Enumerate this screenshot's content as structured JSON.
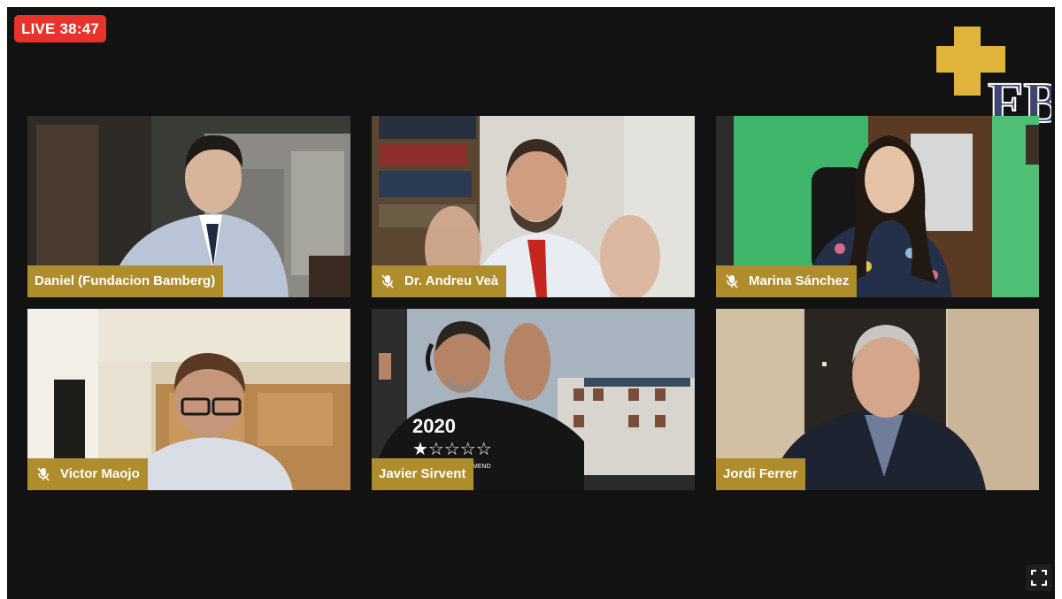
{
  "live": {
    "label": "LIVE",
    "elapsed": "38:47"
  },
  "logo": {
    "letters": "FB",
    "cross_color": "#e0b43a",
    "letters_color": "#3c4670"
  },
  "participants": [
    {
      "name": "Daniel (Fundacion Bamberg)",
      "muted": false,
      "icon": ""
    },
    {
      "name": "Dr. Andreu Veà",
      "muted": true,
      "icon": "mic-off-icon"
    },
    {
      "name": "Marina Sánchez",
      "muted": true,
      "icon": "mic-off-icon"
    },
    {
      "name": "Victor Maojo",
      "muted": true,
      "icon": "mic-off-icon"
    },
    {
      "name": "Javier Sirvent",
      "muted": false,
      "icon": ""
    },
    {
      "name": "Jordi Ferrer",
      "muted": false,
      "icon": ""
    }
  ],
  "shirt_text": {
    "year": "2020",
    "word": "RECOMMEND"
  },
  "colors": {
    "live_badge": "#e8322c",
    "name_tag": "#b08d2c",
    "background": "#121212"
  },
  "controls": {
    "fullscreen_icon": "fullscreen-icon"
  }
}
